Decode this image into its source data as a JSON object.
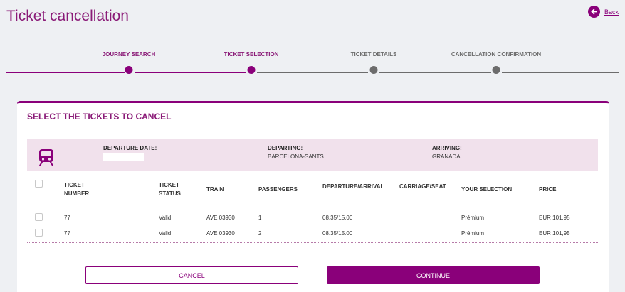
{
  "page": {
    "title": "Ticket cancellation",
    "back_label": "Back"
  },
  "colors": {
    "accent": "#8a007a",
    "inactive": "#6c6c6c",
    "journey_bg": "#f1e1ec"
  },
  "stepper": {
    "steps": [
      {
        "label": "JOURNEY SEARCH",
        "state": "done"
      },
      {
        "label": "TICKET SELECTION",
        "state": "current"
      },
      {
        "label": "TICKET DETAILS",
        "state": "pending"
      },
      {
        "label": "CANCELLATION CONFIRMATION",
        "state": "pending"
      }
    ]
  },
  "card": {
    "title": "SELECT THE TICKETS TO CANCEL",
    "journey": {
      "icon": "train-icon",
      "departure_date_label": "DEPARTURE DATE:",
      "departure_date_value": "",
      "departing_label": "DEPARTING:",
      "departing_value": "BARCELONA-SANTS",
      "arriving_label": "ARRIVING:",
      "arriving_value": "GRANADA"
    },
    "table": {
      "headers": {
        "ticket_number": "TICKET NUMBER",
        "ticket_status": "TICKET STATUS",
        "train": "TRAIN",
        "passengers": "PASSENGERS",
        "departure_arrival": "DEPARTURE/ARRIVAL",
        "carriage_seat": "CARRIAGE/SEAT",
        "your_selection": "YOUR SELECTION",
        "price": "PRICE"
      },
      "rows": [
        {
          "ticket_number": "77",
          "status": "Valid",
          "train": "AVE 03930",
          "passengers": "1",
          "departure_arrival": "08.35/15.00",
          "carriage_seat": "",
          "selection": "Prémium",
          "price": "EUR 101,95"
        },
        {
          "ticket_number": "77",
          "status": "Valid",
          "train": "AVE 03930",
          "passengers": "2",
          "departure_arrival": "08.35/15.00",
          "carriage_seat": "",
          "selection": "Prémium",
          "price": "EUR 101,95"
        }
      ]
    },
    "buttons": {
      "cancel": "CANCEL",
      "continue": "CONTINUE"
    }
  }
}
